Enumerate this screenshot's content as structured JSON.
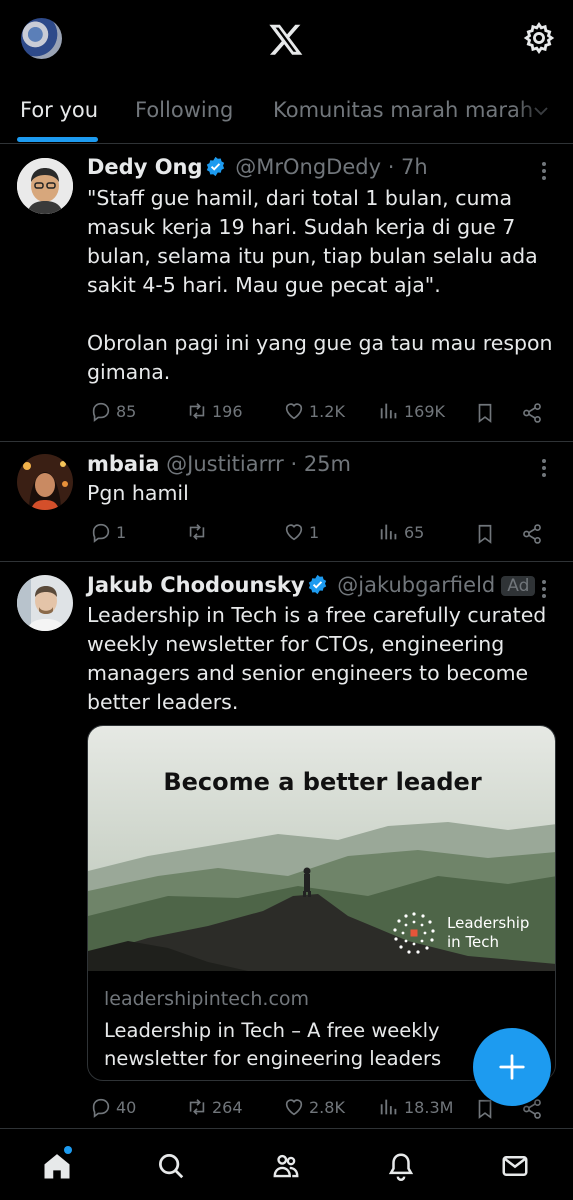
{
  "header": {
    "logo": "x-logo-icon",
    "settings_icon": "gear-icon"
  },
  "tabs": [
    {
      "label": "For you",
      "active": true
    },
    {
      "label": "Following",
      "active": false
    },
    {
      "label": "Komunitas marah marah",
      "active": false
    }
  ],
  "posts": [
    {
      "name": "Dedy Ong",
      "verified": true,
      "handle": "@MrOngDedy",
      "time": "· 7h",
      "text": "\"Staff gue hamil, dari total 1 bulan, cuma masuk kerja 19 hari. Sudah kerja di gue 7 bulan, selama itu pun, tiap bulan selalu ada sakit 4-5 hari. Mau gue pecat aja\".\n\nObrolan pagi ini yang gue ga tau mau respon gimana.",
      "replies": "85",
      "reposts": "196",
      "likes": "1.2K",
      "views": "169K"
    },
    {
      "name": "mbaia",
      "verified": false,
      "handle": "@Justitiarrr",
      "time": "· 25m",
      "text": "Pgn hamil",
      "replies": "1",
      "reposts": "",
      "likes": "1",
      "views": "65"
    },
    {
      "name": "Jakub Chodounsky",
      "verified": true,
      "handle": "@jakubgarfield",
      "ad_label": "Ad",
      "text": "Leadership in Tech is a free carefully curated weekly newsletter for CTOs, engineering managers and senior engineers to become better leaders.",
      "card": {
        "image_headline": "Become a better leader",
        "brand_line1": "Leadership",
        "brand_line2": "in Tech",
        "domain": "leadershipintech.com",
        "title": "Leadership in Tech – A free weekly newsletter for engineering leaders"
      },
      "replies": "40",
      "reposts": "264",
      "likes": "2.8K",
      "views": "18.3M"
    }
  ],
  "colors": {
    "accent": "#1d9bf0",
    "background": "#000000",
    "muted": "#71767b",
    "text": "#e7e9ea"
  },
  "bottom_nav": [
    "home-icon",
    "search-icon",
    "communities-icon",
    "notifications-icon",
    "messages-icon"
  ]
}
